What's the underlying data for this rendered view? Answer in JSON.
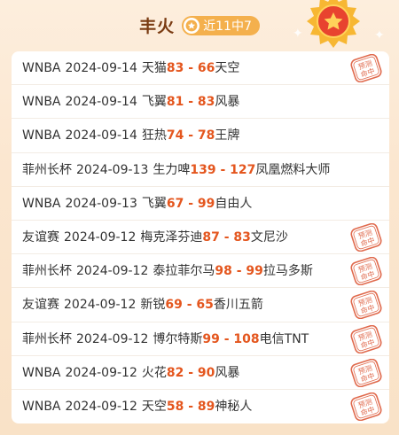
{
  "header": {
    "title": "丰火",
    "badge": "近11中7"
  },
  "stamp_text": [
    "预测",
    "命中"
  ],
  "colors": {
    "score": "#e4561e",
    "title": "#7a3b12",
    "badge": "#f4b04d",
    "stamp": "#e06a4d"
  },
  "rows": [
    {
      "league": "WNBA",
      "date": "2024-09-14",
      "home": "天猫",
      "home_score": "83",
      "sep": " - ",
      "away_score": "66",
      "away": "天空",
      "hit": true
    },
    {
      "league": "WNBA",
      "date": "2024-09-14",
      "home": "飞翼",
      "home_score": "81",
      "sep": " - ",
      "away_score": "83",
      "away": "风暴",
      "hit": false
    },
    {
      "league": "WNBA",
      "date": "2024-09-14",
      "home": "狂热",
      "home_score": "74",
      "sep": " - ",
      "away_score": "78",
      "away": "王牌",
      "hit": false
    },
    {
      "league": "菲州长杯",
      "date": "2024-09-13",
      "home": "生力啤",
      "home_score": "139",
      "sep": " - ",
      "away_score": "127",
      "away": "凤凰燃料大师",
      "hit": false
    },
    {
      "league": "WNBA",
      "date": "2024-09-13",
      "home": "飞翼",
      "home_score": "67",
      "sep": " - ",
      "away_score": "99",
      "away": "自由人",
      "hit": false
    },
    {
      "league": "友谊赛",
      "date": "2024-09-12",
      "home": "梅克泽芬迪",
      "home_score": "87",
      "sep": " - ",
      "away_score": "83",
      "away": "文尼沙",
      "hit": true
    },
    {
      "league": "菲州长杯",
      "date": "2024-09-12",
      "home": "泰拉菲尔马",
      "home_score": "98",
      "sep": " - ",
      "away_score": "99",
      "away": "拉马多斯",
      "hit": true
    },
    {
      "league": "友谊赛",
      "date": "2024-09-12",
      "home": "新锐",
      "home_score": "69",
      "sep": " - ",
      "away_score": "65",
      "away": "香川五箭",
      "hit": true
    },
    {
      "league": "菲州长杯",
      "date": "2024-09-12",
      "home": "博尔特斯",
      "home_score": "99",
      "sep": " - ",
      "away_score": "108",
      "away": "电信TNT",
      "hit": true
    },
    {
      "league": "WNBA",
      "date": "2024-09-12",
      "home": "火花",
      "home_score": "82",
      "sep": " - ",
      "away_score": "90",
      "away": "风暴",
      "hit": true
    },
    {
      "league": "WNBA",
      "date": "2024-09-12",
      "home": "天空",
      "home_score": "58",
      "sep": " - ",
      "away_score": "89",
      "away": "神秘人",
      "hit": true
    }
  ]
}
